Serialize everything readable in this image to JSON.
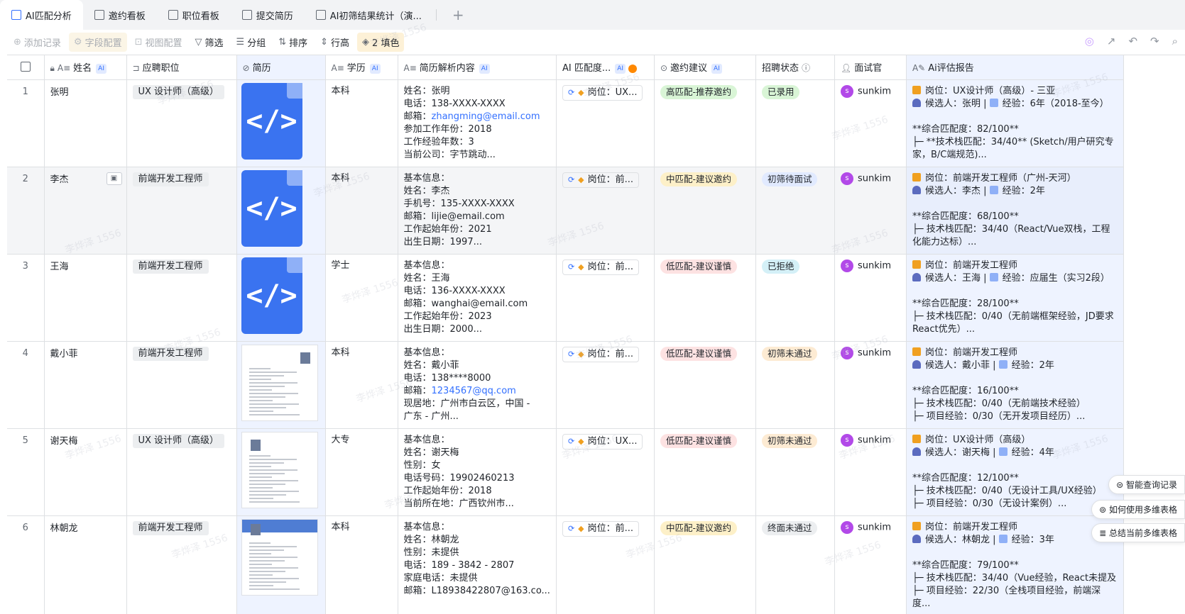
{
  "tabs": [
    {
      "label": "AI匹配分析",
      "icon": "table-icon",
      "active": true
    },
    {
      "label": "邀约看板",
      "icon": "kanban-icon",
      "active": false
    },
    {
      "label": "职位看板",
      "icon": "kanban-icon",
      "active": false
    },
    {
      "label": "提交简历",
      "icon": "form-icon",
      "active": false
    },
    {
      "label": "AI初筛结果统计（演...",
      "icon": "dashboard-icon",
      "active": false
    }
  ],
  "toolbar": {
    "add_record": "添加记录",
    "field_config": "字段配置",
    "view_config": "视图配置",
    "filter": "筛选",
    "group": "分组",
    "sort": "排序",
    "row_height": "行高",
    "fill": "2 填色"
  },
  "columns": {
    "name": "姓名",
    "position": "应聘职位",
    "resume": "简历",
    "education": "学历",
    "parse": "简历解析内容",
    "match": "AI 匹配度...",
    "invite": "邀约建议",
    "status": "招聘状态",
    "interviewer": "面试官",
    "report": "Ai评估报告",
    "ai_badge": "AI"
  },
  "rows": [
    {
      "num": "1",
      "name": "张明",
      "position": "UX 设计师（高级）",
      "resume": "code",
      "education": "本科",
      "parse": [
        "姓名：张明",
        "电话：138-XXXX-XXXX",
        "邮箱：",
        "参加工作年份：2018",
        "工作经验年数：3",
        "当前公司：字节跳动..."
      ],
      "email": "zhangming@email.com",
      "match": "岗位：UX...",
      "invite": "高匹配-推荐邀约",
      "status": "已录用",
      "interviewer": "sunkim",
      "report": [
        "岗位：UX设计师（高级）- 三亚",
        "候选人：张明 | ",
        "经验：6年（2018-至今）",
        "**综合匹配度：82/100**",
        "├─ **技术栈匹配：34/40** (Sketch/用户研究专家，B/C端规范)..."
      ]
    },
    {
      "num": "2",
      "name": "李杰",
      "position": "前端开发工程师",
      "resume": "code",
      "education": "本科",
      "parse": [
        "基本信息：",
        "姓名：李杰",
        "手机号：135-XXXX-XXXX",
        "邮箱：lijie@email.com",
        "工作起始年份：2021",
        "出生日期：1997..."
      ],
      "email": "",
      "match": "岗位：前...",
      "invite": "中匹配-建议邀约",
      "status": "初筛待面试",
      "interviewer": "sunkim",
      "report": [
        "岗位：前端开发工程师（广州-天河）",
        "候选人：李杰 | ",
        "经验：2年",
        "**综合匹配度：68/100**",
        "├─ 技术栈匹配：34/40（React/Vue双栈，工程化能力达标）..."
      ]
    },
    {
      "num": "3",
      "name": "王海",
      "position": "前端开发工程师",
      "resume": "code",
      "education": "学士",
      "parse": [
        "基本信息：",
        "姓名：王海",
        "电话：136-XXXX-XXXX",
        "邮箱：wanghai@email.com",
        "工作起始年份：2023",
        "出生日期：2000..."
      ],
      "email": "",
      "match": "岗位：前...",
      "invite": "低匹配-建议谨慎",
      "status": "已拒绝",
      "interviewer": "sunkim",
      "report": [
        "岗位：前端开发工程师",
        "候选人：王海 | ",
        "经验：应届生（实习2段）",
        "**综合匹配度：28/100**",
        "├─ 技术栈匹配：0/40（无前端框架经验，JD要求React优先）..."
      ]
    },
    {
      "num": "4",
      "name": "戴小菲",
      "position": "前端开发工程师",
      "resume": "thumb-a",
      "education": "本科",
      "parse": [
        "基本信息：",
        "姓名：戴小菲",
        "电话：138****8000",
        "邮箱：",
        "现居地：广州市白云区，中国 -",
        "广东 - 广州..."
      ],
      "email": "1234567@qq.com",
      "match": "岗位：前...",
      "invite": "低匹配-建议谨慎",
      "status": "初筛未通过",
      "interviewer": "sunkim",
      "report": [
        "岗位：前端开发工程师",
        "候选人：戴小菲 | ",
        "经验：2年",
        "**综合匹配度：16/100**",
        "├─ 技术栈匹配：0/40（无前端技术经验）",
        "├─ 项目经验：0/30（无开发项目经历）..."
      ]
    },
    {
      "num": "5",
      "name": "谢天梅",
      "position": "UX 设计师（高级）",
      "resume": "thumb-b",
      "education": "大专",
      "parse": [
        "基本信息：",
        "姓名：谢天梅",
        "性别：女",
        "电话号码：19902460213",
        "工作起始年份：2018",
        "当前所在地：广西钦州市..."
      ],
      "email": "",
      "match": "岗位：UX...",
      "invite": "低匹配-建议谨慎",
      "status": "初筛未通过",
      "interviewer": "sunkim",
      "report": [
        "岗位：UX设计师（高级）",
        "候选人：谢天梅 | ",
        "经验：4年",
        "**综合匹配度：12/100**",
        "├─ 技术栈匹配：0/40（无设计工具/UX经验）",
        "├─ 项目经验：0/30（无设计案例）..."
      ]
    },
    {
      "num": "6",
      "name": "林朝龙",
      "position": "前端开发工程师",
      "resume": "thumb-c",
      "education": "本科",
      "parse": [
        "基本信息：",
        "姓名：林朝龙",
        "性别：未提供",
        "电话：189 - 3842 - 2807",
        "家庭电话：未提供",
        "邮箱：L18938422807@163.co..."
      ],
      "email": "",
      "match": "岗位：前...",
      "invite": "中匹配-建议邀约",
      "status": "终面未通过",
      "interviewer": "sunkim",
      "report": [
        "岗位：前端开发工程师",
        "候选人：林朝龙 | ",
        "经验：3年",
        "**综合匹配度：79/100**",
        "├─ 技术栈匹配：34/40（Vue经验，React未提及",
        "├─ 项目经验：22/30（全栈项目经验，前端深度..."
      ]
    }
  ],
  "floating": {
    "smart_query": "智能查询记录",
    "how_to_use": "如何使用多维表格",
    "summarize": "总结当前多维表格"
  },
  "watermark": "李烨泽 1556",
  "colors": {
    "accent": "#3370ff",
    "invite_high": "#d9f5d6",
    "invite_mid": "#fdf0c8",
    "invite_low": "#fde2e2",
    "status_hired": "#d9f5d6",
    "status_pending": "#e1eaff",
    "status_rejected": "#d4f0f7",
    "status_fail": "#fdebd3",
    "status_final_fail": "#eceef0"
  }
}
